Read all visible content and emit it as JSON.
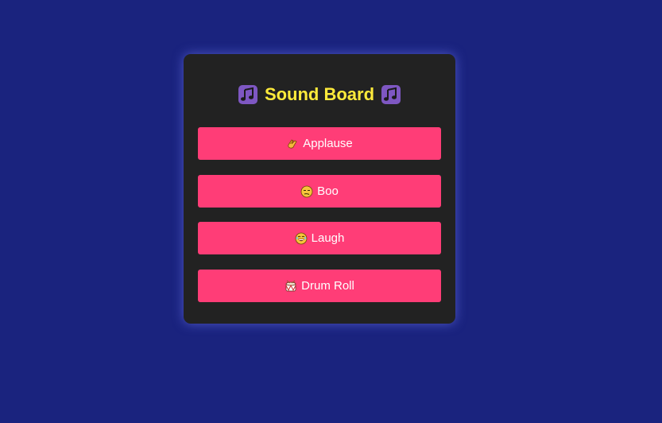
{
  "board": {
    "title": "Sound Board",
    "left_icon": "musical-notes-icon",
    "right_icon": "musical-notes-icon"
  },
  "buttons": [
    {
      "label": "Applause",
      "icon": "clapping-hands-icon"
    },
    {
      "label": "Boo",
      "icon": "unamused-face-icon"
    },
    {
      "label": "Laugh",
      "icon": "laughing-face-icon"
    },
    {
      "label": "Drum Roll",
      "icon": "drum-icon"
    }
  ],
  "colors": {
    "background": "#1a237e",
    "panel": "#222222",
    "title": "#ffeb3b",
    "button": "#ff3d77",
    "button_text": "#ffffff",
    "note_icon": "#7e57c2"
  }
}
